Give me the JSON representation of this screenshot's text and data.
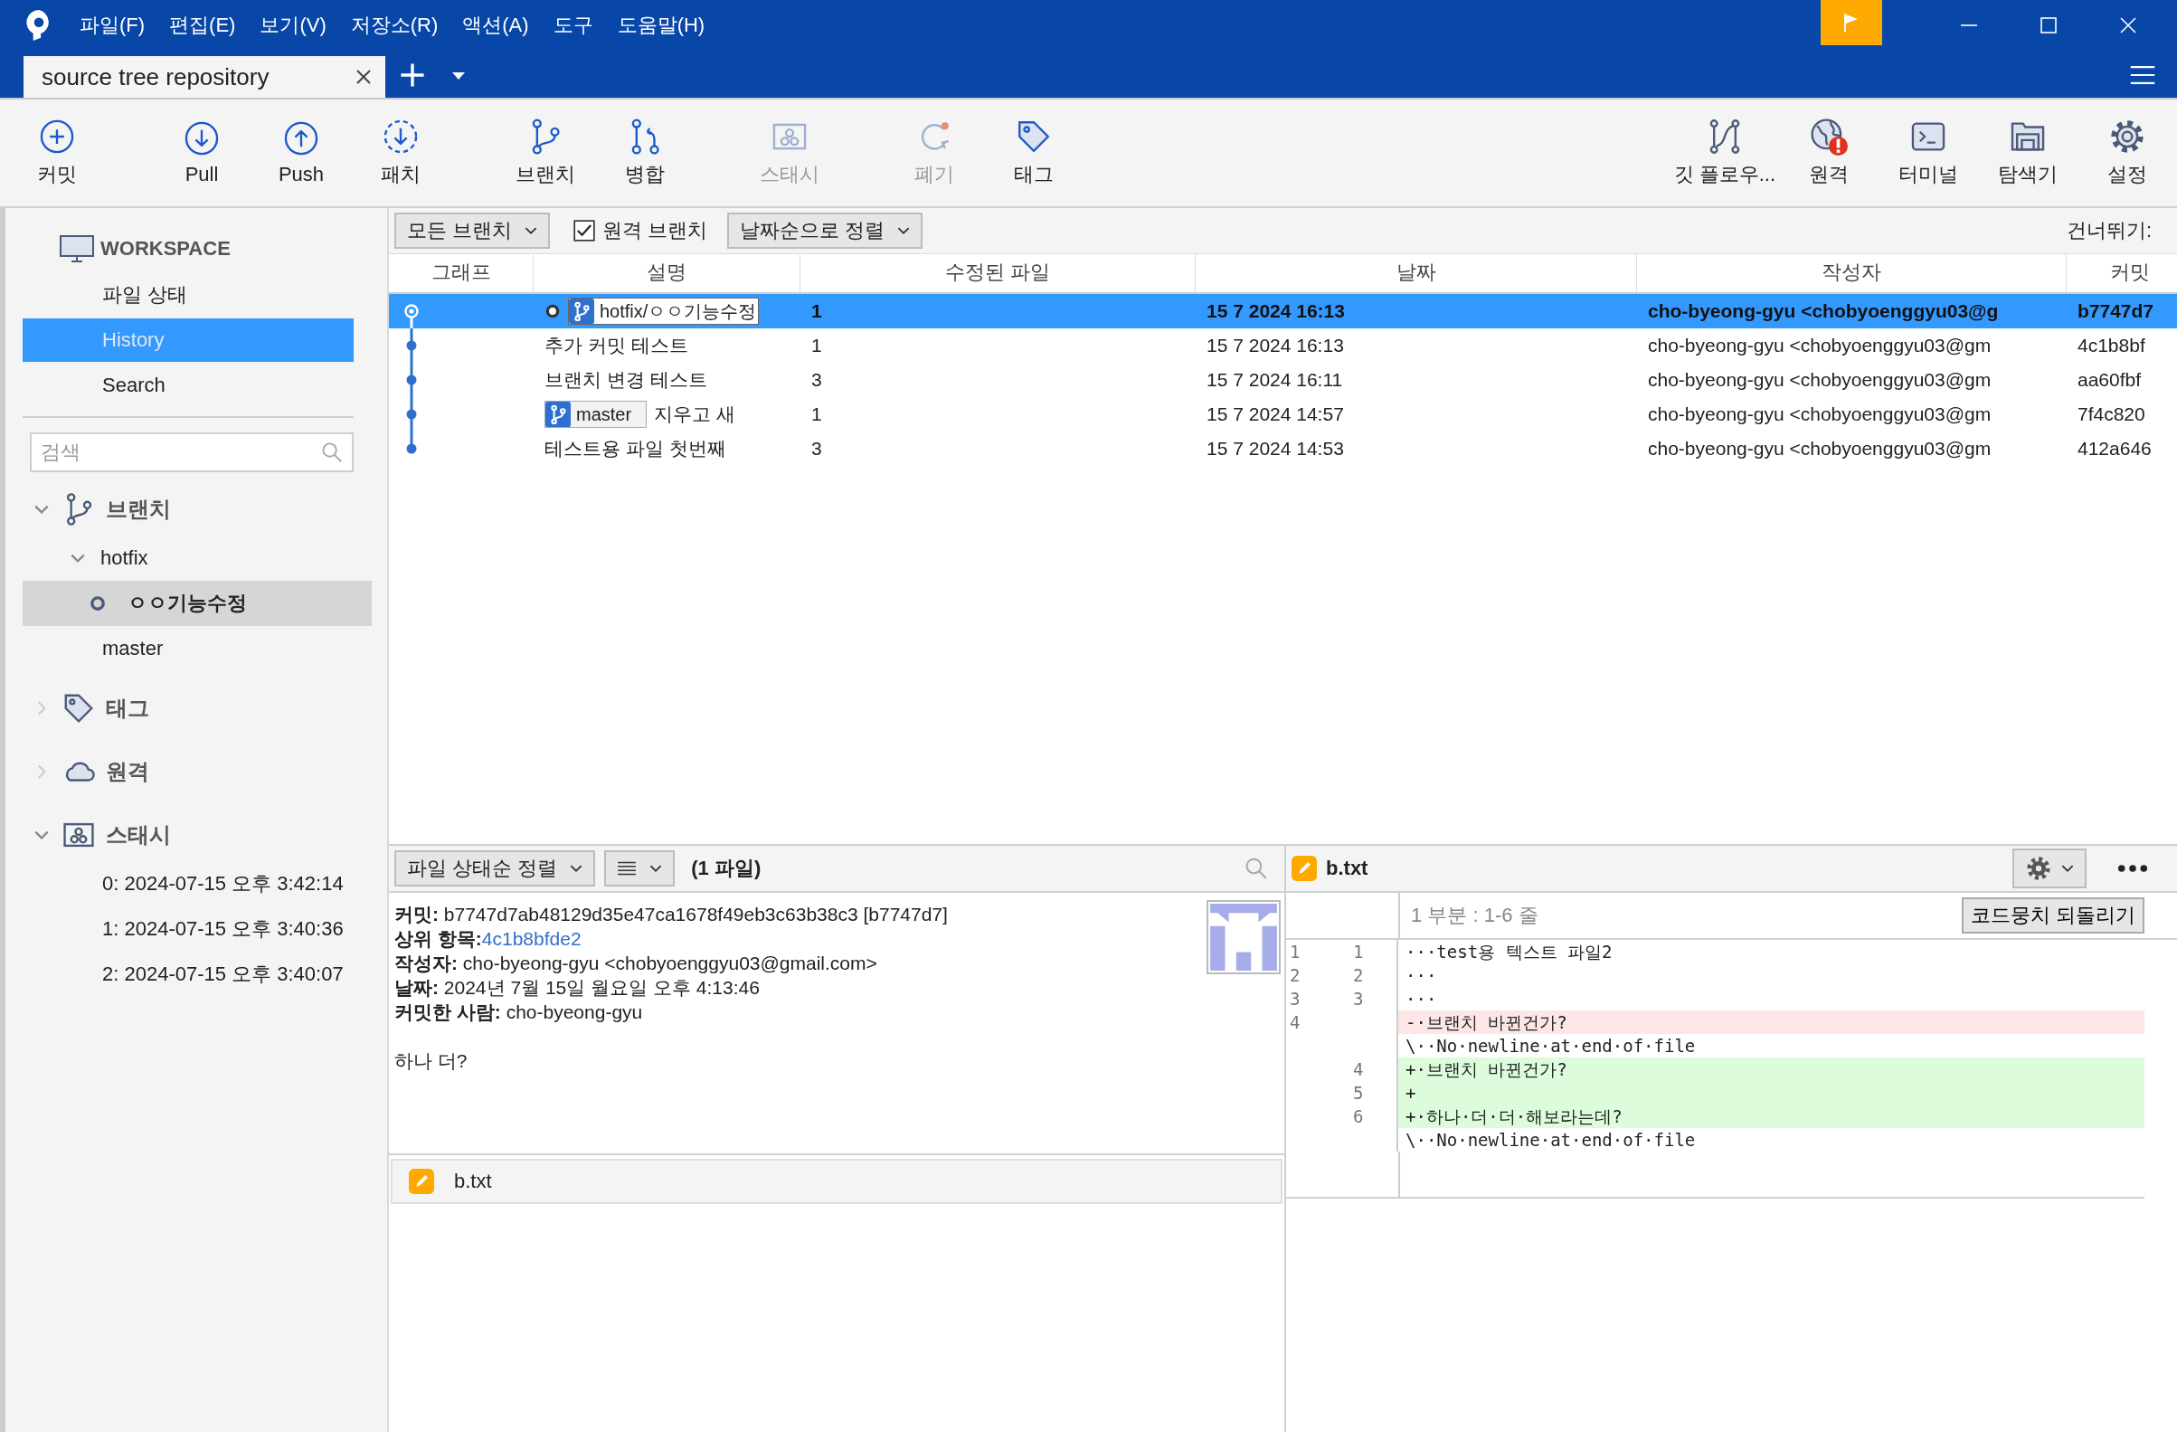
{
  "window": {
    "menu": [
      "파일(F)",
      "편집(E)",
      "보기(V)",
      "저장소(R)",
      "액션(A)",
      "도구",
      "도움말(H)"
    ],
    "tab": {
      "title": "source tree repository"
    }
  },
  "toolbar": {
    "left_groups": [
      [
        {
          "label": "커밋",
          "disabled": false
        }
      ],
      [
        {
          "label": "Pull",
          "disabled": false
        },
        {
          "label": "Push",
          "disabled": false
        },
        {
          "label": "패치",
          "disabled": false
        }
      ],
      [
        {
          "label": "브랜치",
          "disabled": false
        },
        {
          "label": "병합",
          "disabled": false
        }
      ],
      [
        {
          "label": "스태시",
          "disabled": true
        }
      ],
      [
        {
          "label": "폐기",
          "disabled": true
        },
        {
          "label": "태그",
          "disabled": false
        }
      ]
    ],
    "right": [
      {
        "label": "깃 플로우...",
        "disabled": false
      },
      {
        "label": "원격",
        "disabled": false
      },
      {
        "label": "터미널",
        "disabled": false
      },
      {
        "label": "탐색기",
        "disabled": false
      },
      {
        "label": "설정",
        "disabled": false
      }
    ]
  },
  "sidebar": {
    "workspace": {
      "label": "WORKSPACE",
      "items": [
        {
          "label": "파일 상태",
          "selected": false
        },
        {
          "label": "History",
          "selected": true
        },
        {
          "label": "Search",
          "selected": false
        }
      ]
    },
    "search": {
      "placeholder": "검색"
    },
    "sections": [
      {
        "label": "브랜치",
        "expanded": true,
        "children": [
          {
            "label": "hotfix",
            "expanded": true,
            "children": [
              {
                "label": "ㅇㅇ기능수정",
                "current": true,
                "selected": true
              }
            ]
          },
          {
            "label": "master",
            "current": false,
            "selected": false
          }
        ]
      },
      {
        "label": "태그",
        "expanded": false
      },
      {
        "label": "원격",
        "expanded": false
      },
      {
        "label": "스태시",
        "expanded": true,
        "children": [
          {
            "label": "0: 2024-07-15 오후 3:42:14",
            "selected": false
          },
          {
            "label": "1: 2024-07-15 오후 3:40:36",
            "selected": false
          },
          {
            "label": "2: 2024-07-15 오후 3:40:07",
            "selected": false
          }
        ]
      }
    ]
  },
  "history": {
    "filters": {
      "branches": "모든 브랜치",
      "remote": {
        "label": "원격 브랜치",
        "checked": true
      },
      "sort": "날짜순으로 정렬",
      "jump": "건너뛰기:"
    },
    "columns": [
      "그래프",
      "설명",
      "수정된 파일",
      "날짜",
      "작성자",
      "커밋"
    ],
    "rows": [
      {
        "selected": true,
        "current": true,
        "refs": [
          {
            "label": "hotfix/ㅇㅇ기능수정",
            "selected": true
          }
        ],
        "files": "1",
        "date": "15 7 2024 16:13",
        "author": "cho-byeong-gyu <chobyoenggyu03@g",
        "commit": "b7747d7"
      },
      {
        "selected": false,
        "current": false,
        "description": "추가 커밋 테스트",
        "files": "1",
        "date": "15 7 2024 16:13",
        "author": "cho-byeong-gyu <chobyoenggyu03@gm",
        "commit": "4c1b8bf"
      },
      {
        "selected": false,
        "current": false,
        "description": "브랜치 변경 테스트",
        "files": "3",
        "date": "15 7 2024 16:11",
        "author": "cho-byeong-gyu <chobyoenggyu03@gm",
        "commit": "aa60fbf"
      },
      {
        "selected": false,
        "current": false,
        "refs": [
          {
            "label": "master",
            "selected": false
          }
        ],
        "description": "지우고 새",
        "files": "1",
        "date": "15 7 2024 14:57",
        "author": "cho-byeong-gyu <chobyoenggyu03@gm",
        "commit": "7f4c820"
      },
      {
        "selected": false,
        "current": false,
        "description": "테스트용 파일 첫번째",
        "files": "3",
        "date": "15 7 2024 14:53",
        "author": "cho-byeong-gyu <chobyoenggyu03@gm",
        "commit": "412a646"
      }
    ]
  },
  "files_panel": {
    "sort": "파일 상태순 정렬",
    "count": "(1 파일)",
    "details": [
      {
        "kind": "text",
        "text": "**커밋:** b7747d7ab48129d35e47ca1678f49eb3c63b38c3 [b7747d7]"
      },
      {
        "kind": "link",
        "label": "상위 항목:",
        "link": "4c1b8bfde2"
      },
      {
        "kind": "text",
        "text": "**작성자:** cho-byeong-gyu <chobyoenggyu03@gmail.com>"
      },
      {
        "kind": "text",
        "text": "**날짜:** 2024년 7월 15일 월요일 오후 4:13:46"
      },
      {
        "kind": "text",
        "text": "**커밋한 사람:** cho-byeong-gyu"
      }
    ],
    "message": "하나 더?",
    "files": [
      {
        "name": "b.txt",
        "selected": false
      }
    ]
  },
  "diff": {
    "file": "b.txt",
    "hunk": "1 부분 : 1-6 줄",
    "revert": "코드뭉치 되돌리기",
    "lines": [
      {
        "kind": "context",
        "old": "1",
        "new": "1",
        "text": "···test용 텍스트 파일2"
      },
      {
        "kind": "context",
        "old": "2",
        "new": "2",
        "text": "···"
      },
      {
        "kind": "context",
        "old": "3",
        "new": "3",
        "text": "···"
      },
      {
        "kind": "removed",
        "old": "4",
        "text": "-·브랜치 바뀐건가?"
      },
      {
        "kind": "note",
        "text": "\\··No·newline·at·end·of·file"
      },
      {
        "kind": "added",
        "new": "4",
        "text": "+·브랜치 바뀐건가?"
      },
      {
        "kind": "added",
        "new": "5",
        "text": "+"
      },
      {
        "kind": "added",
        "new": "6",
        "text": "+·하나·더·더·해보라는데?"
      },
      {
        "kind": "note",
        "text": "\\··No·newline·at·end·of·file"
      }
    ]
  }
}
